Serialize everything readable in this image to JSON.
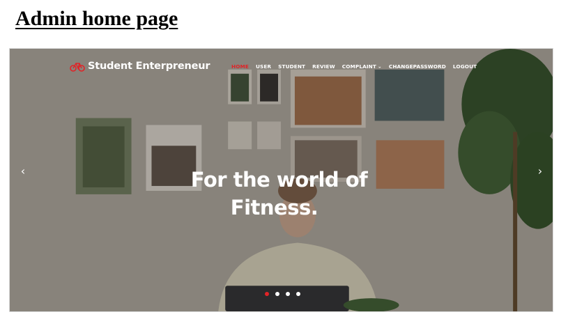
{
  "doc": {
    "heading": "Admin home page"
  },
  "site": {
    "brand": "Student Enterpreneur",
    "brand_icon": "bicycle-icon",
    "accent_color": "#e12327"
  },
  "nav": {
    "items": [
      {
        "label": "HOME",
        "active": true
      },
      {
        "label": "USER"
      },
      {
        "label": "STUDENT"
      },
      {
        "label": "REVIEW"
      },
      {
        "label": "COMPLAINT",
        "dropdown": true
      },
      {
        "label": "CHANGEPASSWORD"
      },
      {
        "label": "LOGOUT"
      }
    ]
  },
  "hero": {
    "title_line1": "For the world of",
    "title_line2": "Fitness.",
    "prev_icon": "chevron-left-icon",
    "next_icon": "chevron-right-icon"
  },
  "carousel": {
    "slide_count": 4,
    "active_index": 0
  }
}
